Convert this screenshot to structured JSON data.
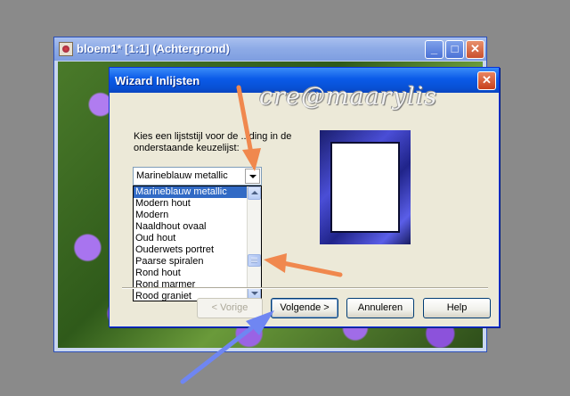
{
  "background_window": {
    "title": "bloem1* [1:1] (Achtergrond)",
    "minimize": "_",
    "maximize": "□",
    "close": "✕"
  },
  "dialog": {
    "title": "Wizard Inlijsten",
    "close": "✕",
    "watermark": "cre@maarylis",
    "instruction": "Kies een lijststijl voor de ...ding in de onderstaande keuzelijst:",
    "combo_value": "Marineblauw metallic",
    "list_items": [
      "Marineblauw metallic",
      "Modern hout",
      "Modern",
      "Naaldhout ovaal",
      "Oud hout",
      "Ouderwets portret",
      "Paarse spiralen",
      "Rond hout",
      "Rond marmer",
      "Rood graniet"
    ],
    "selected_index": 0,
    "buttons": {
      "back": "< Vorige",
      "next": "Volgende >",
      "cancel": "Annuleren",
      "help": "Help"
    }
  },
  "colors": {
    "annotation_orange": "#f0884e",
    "annotation_blue": "#6f86f2",
    "selection": "#316ac5",
    "titlebar": "#0a5ae8"
  }
}
